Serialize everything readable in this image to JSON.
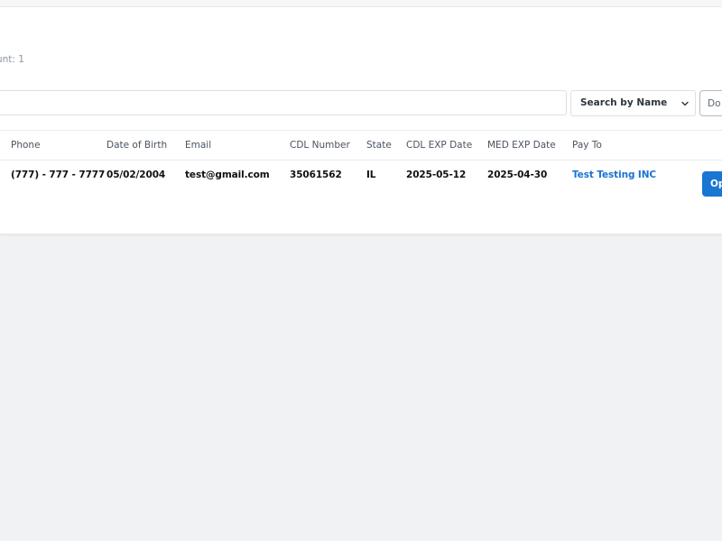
{
  "header": {
    "count_text": "unt: 1"
  },
  "search": {
    "placeholder": "",
    "value": ""
  },
  "filter": {
    "selected": "Search by Name"
  },
  "export_button": {
    "label": "Do"
  },
  "table": {
    "columns": [
      "Phone",
      "Date of Birth",
      "Email",
      "CDL Number",
      "State",
      "CDL EXP Date",
      "MED EXP Date",
      "Pay To"
    ],
    "rows": [
      {
        "phone": "(777) - 777 - 7777",
        "dob": "05/02/2004",
        "email": "test@gmail.com",
        "cdl_number": "35061562",
        "state": "IL",
        "cdl_exp": "2025-05-12",
        "med_exp": "2025-04-30",
        "pay_to": "Test Testing INC",
        "action_label": "Op"
      }
    ]
  },
  "colors": {
    "accent": "#1976d2",
    "link": "#1a73d1",
    "page_background": "#f1f2f4"
  },
  "icons": {
    "select": "chevron-down-icon"
  }
}
